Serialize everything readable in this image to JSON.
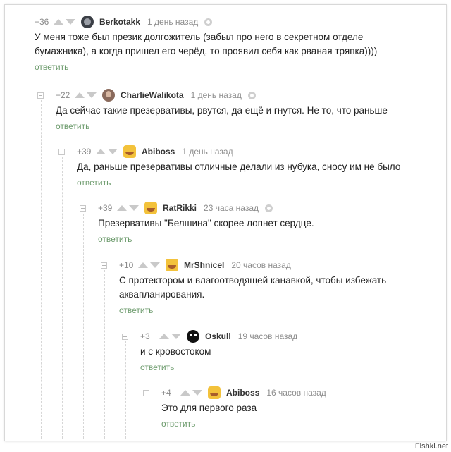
{
  "comments": [
    {
      "rating": "+36",
      "user": "Berkotakk",
      "time": "1 день назад",
      "text": "У меня тоже был презик долгожитель (забыл про него в секретном отделе бумажника), а когда пришел его черёд, то проявил себя как рваная тряпка))))",
      "reply": "ответить",
      "avatar": "dark-avatar"
    },
    {
      "rating": "+22",
      "user": "CharlieWalikota",
      "time": "1 день назад",
      "text": "Да сейчас такие презервативы, рвутся, да ещё и гнутся. Не то, что раньше",
      "reply": "ответить",
      "avatar": "photo-avatar"
    },
    {
      "rating": "+39",
      "user": "Abiboss",
      "time": "1 день назад",
      "text": "Да, раньше презервативы отличные делали из нубука, сносу им не было",
      "reply": "ответить",
      "avatar": "smile-avatar"
    },
    {
      "rating": "+39",
      "user": "RatRikki",
      "time": "23 часа назад",
      "text": "Презервативы \"Белшина\" скорее лопнет сердце.",
      "reply": "ответить",
      "avatar": "smile-avatar"
    },
    {
      "rating": "+10",
      "user": "MrShnicel",
      "time": "20 часов назад",
      "text": "С протектором и влагоотводящей канавкой, чтобы избежать аквапланирования.",
      "reply": "ответить",
      "avatar": "smile-avatar"
    },
    {
      "rating": "+3",
      "user": "Oskull",
      "time": "19 часов назад",
      "text": "и с кровостоком",
      "reply": "ответить",
      "avatar": "black-avatar"
    },
    {
      "rating": "+4",
      "user": "Abiboss",
      "time": "16 часов назад",
      "text": "Это для первого раза",
      "reply": "ответить",
      "avatar": "smile-avatar"
    }
  ],
  "watermark": "Fishki.net",
  "colors": {
    "reply_link": "#6b9a6b",
    "meta_text": "#8d8d8d",
    "arrows": "#c9c9c9"
  }
}
